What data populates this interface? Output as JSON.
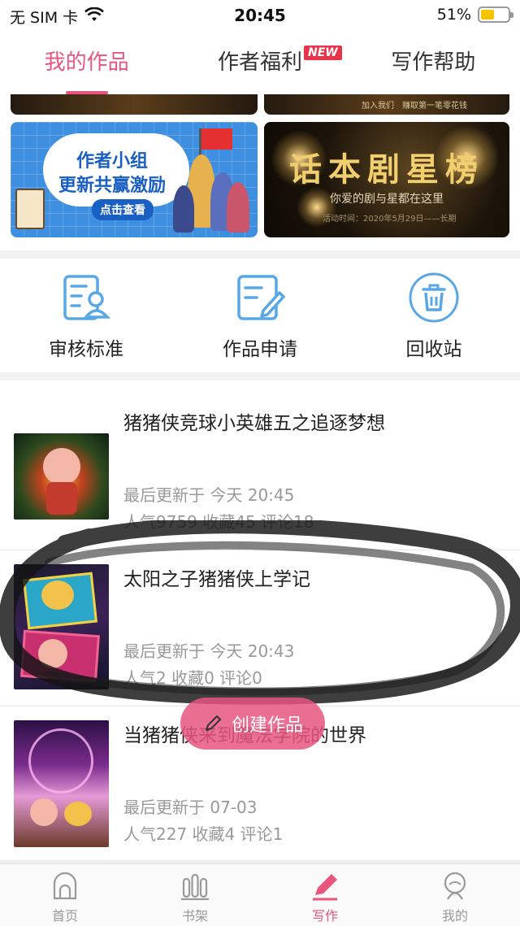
{
  "status_bar": {
    "carrier": "无 SIM 卡",
    "time": "20:45",
    "battery": "51%",
    "battery_level": 0.51
  },
  "top_tabs": [
    {
      "label": "我的作品",
      "active": true
    },
    {
      "label": "作者福利",
      "badge": "NEW",
      "active": false
    },
    {
      "label": "写作帮助",
      "active": false
    }
  ],
  "banners": {
    "left": {
      "line1": "作者小组",
      "line2": "更新共赢激励",
      "button": "点击查看"
    },
    "right": {
      "title": "话本剧星榜",
      "subtitle": "你爱的剧与星都在这里",
      "date": "活动时间：2020年5月29日——长期"
    },
    "strip_text": "加入我们　赚取第一笔零花钱"
  },
  "actions": [
    {
      "label": "审核标准",
      "icon": "review-standard-icon"
    },
    {
      "label": "作品申请",
      "icon": "work-apply-icon"
    },
    {
      "label": "回收站",
      "icon": "recycle-bin-icon"
    }
  ],
  "works": [
    {
      "title": "猪猪侠竞球小英雄五之追逐梦想",
      "updated": "最后更新于 今天 20:45",
      "stats": "人气9759 收藏45 评论18"
    },
    {
      "title": "太阳之子猪猪侠上学记",
      "updated": "最后更新于 今天 20:43",
      "stats": "人气2 收藏0 评论0"
    },
    {
      "title": "当猪猪侠来到魔法学院的世界",
      "updated": "最后更新于 07-03",
      "stats": "人气227 收藏4 评论1"
    }
  ],
  "create_button": {
    "label": "创建作品"
  },
  "bottom_nav": [
    {
      "label": "首页",
      "icon": "home-icon",
      "active": false
    },
    {
      "label": "书架",
      "icon": "bookshelf-icon",
      "active": false
    },
    {
      "label": "写作",
      "icon": "write-icon",
      "active": true
    },
    {
      "label": "我的",
      "icon": "profile-icon",
      "active": false
    }
  ],
  "colors": {
    "accent": "#e8567f",
    "badge": "#e8334a",
    "action_icon": "#5aa7e6",
    "meta_text": "#999999"
  }
}
